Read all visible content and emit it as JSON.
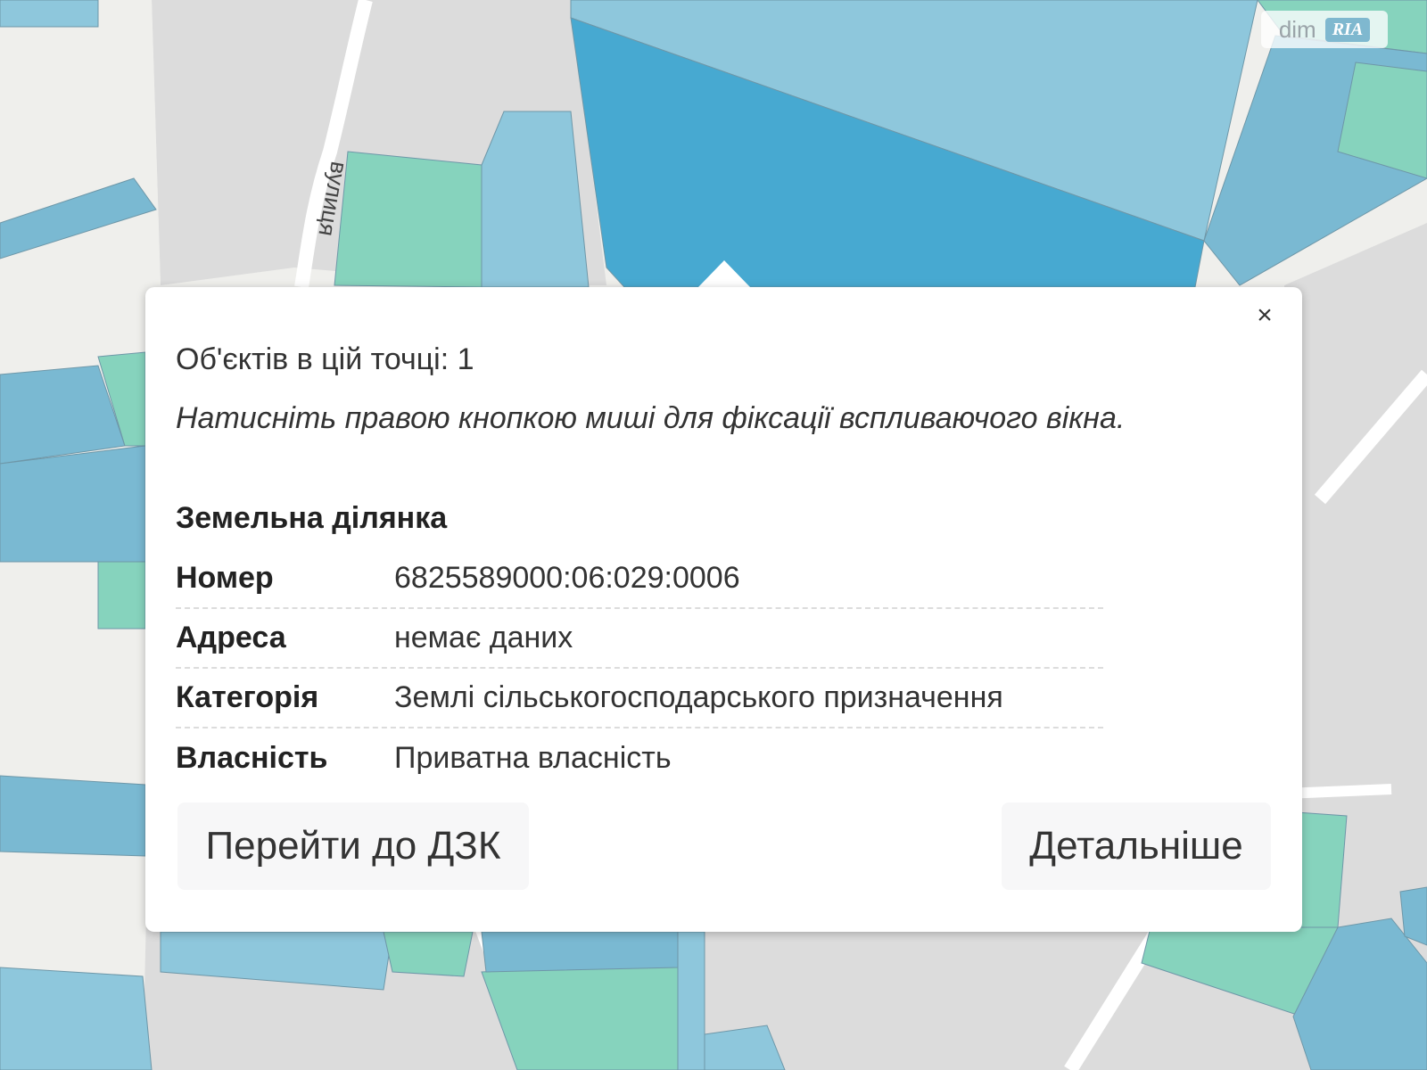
{
  "map": {
    "street_label": "вулиця",
    "colors": {
      "background": "#efefec",
      "road": "#dcdcdc",
      "road_white": "#ffffff",
      "parcel_light": "#8ec7dc",
      "parcel_medium": "#7ab9d2",
      "parcel_selected": "#47a9d1",
      "parcel_green": "#86d3bd"
    }
  },
  "watermark": {
    "dim": "dim",
    "ria": "RIA"
  },
  "popup": {
    "close_symbol": "×",
    "objects_count_label": "Об'єктів в цій точці: 1",
    "hint": "Натисніть правою кнопкою миші для фіксації вспливаючого вікна.",
    "section_title": "Земельна ділянка",
    "attributes": [
      {
        "key": "Номер",
        "value": "6825589000:06:029:0006"
      },
      {
        "key": "Адреса",
        "value": "немає даних"
      },
      {
        "key": "Категорія",
        "value": "Землі сільськогосподарського призначення"
      },
      {
        "key": "Власність",
        "value": "Приватна власність"
      }
    ],
    "buttons": {
      "go_to_dzk": "Перейти до ДЗК",
      "details": "Детальніше"
    }
  }
}
